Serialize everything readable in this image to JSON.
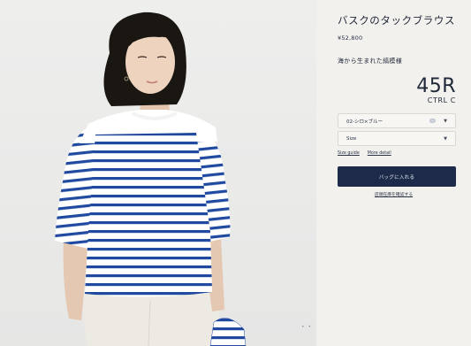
{
  "product": {
    "title": "バスクのタックブラウス",
    "price": "¥52,800",
    "tagline": "海から生まれた縞模様"
  },
  "brand": {
    "logo_main": "45R",
    "logo_sub": "CTRL C"
  },
  "options": {
    "color_selected": "02-シロ×ブルー",
    "size_selected": "Size"
  },
  "links": {
    "size_guide": "Size guide",
    "more_detail": "More detail"
  },
  "actions": {
    "add_to_cart": "バッグに入れる",
    "check_store_stock": "店頭在庫を確認する"
  },
  "gallery": {
    "pager": "• •"
  },
  "colors": {
    "button_bg": "#1e2a4a",
    "stripe_blue": "#1f4aa0",
    "panel_bg": "#f2f1ed"
  }
}
